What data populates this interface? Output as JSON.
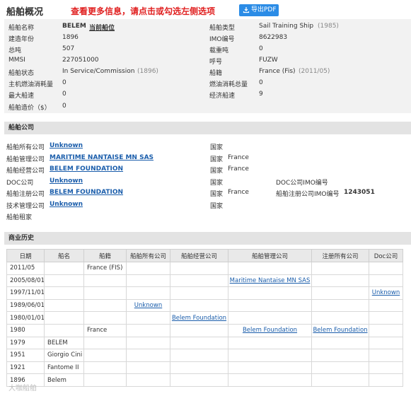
{
  "header": {
    "title": "船舶概况",
    "notice": "查看更多信息，请点击或勾选左侧选项",
    "pdf_button": "导出PDF"
  },
  "overview": {
    "name_label": "船舶名称",
    "name_value": "BELEM",
    "name_link": "当前船位",
    "type_label": "船舶类型",
    "type_value": "Sail Training Ship",
    "type_year": "(1985)",
    "built_label": "建造年份",
    "built_value": "1896",
    "imo_label": "IMO编号",
    "imo_value": "8622983",
    "gt_label": "总吨",
    "gt_value": "507",
    "dwt_label": "载重吨",
    "dwt_value": "0",
    "mmsi_label": "MMSI",
    "mmsi_value": "227051000",
    "callsign_label": "呼号",
    "callsign_value": "FUZW",
    "status_label": "船舶状态",
    "status_value": "In Service/Commission",
    "status_year": "(1896)",
    "flag_label": "船籍",
    "flag_value": "France (Fis)",
    "flag_date": "(2011/05)",
    "main_fuel_label": "主机燃油消耗量",
    "main_fuel_value": "0",
    "total_fuel_label": "燃油消耗总量",
    "total_fuel_value": "0",
    "max_speed_label": "最大船速",
    "max_speed_value": "0",
    "eco_speed_label": "经济船速",
    "eco_speed_value": "9",
    "price_label": "船舶造价（$）",
    "price_value": "0"
  },
  "company": {
    "section_title": "船舶公司",
    "country_label": "国家",
    "owner_label": "船舶所有公司",
    "owner_value": "Unknown",
    "manager_label": "船舶管理公司",
    "manager_value": "MARITIME NANTAISE MN SAS",
    "manager_country": "France",
    "operator_label": "船舶经营公司",
    "operator_value": "BELEM FOUNDATION",
    "operator_country": "France",
    "doc_label": "DOC公司",
    "doc_value": "Unknown",
    "doc_imo_label": "DOC公司IMO编号",
    "reg_owner_label": "船舶注册公司",
    "reg_owner_value": "BELEM FOUNDATION",
    "reg_owner_country": "France",
    "reg_imo_label": "船舶注册公司IMO编号",
    "reg_imo_value": "1243051",
    "tech_label": "技术管理公司",
    "tech_value": "Unknown",
    "charter_label": "船舶租家"
  },
  "history": {
    "section_title": "商业历史",
    "headers": [
      "日期",
      "船名",
      "船籍",
      "船舶所有公司",
      "船舶经营公司",
      "船舶管理公司",
      "注册所有公司",
      "Doc公司"
    ],
    "rows": [
      {
        "date": "2011/05",
        "name": "",
        "flag": "France (FIS)",
        "owner": "",
        "operator": "",
        "manager": "",
        "reg_owner": "",
        "doc": ""
      },
      {
        "date": "2005/08/01",
        "name": "",
        "flag": "",
        "owner": "",
        "operator": "",
        "manager": "Maritime Nantaise MN SAS",
        "reg_owner": "",
        "doc": ""
      },
      {
        "date": "1997/11/01",
        "name": "",
        "flag": "",
        "owner": "",
        "operator": "",
        "manager": "",
        "reg_owner": "",
        "doc": "Unknown"
      },
      {
        "date": "1989/06/01",
        "name": "",
        "flag": "",
        "owner": "Unknown",
        "operator": "",
        "manager": "",
        "reg_owner": "",
        "doc": ""
      },
      {
        "date": "1980/01/01",
        "name": "",
        "flag": "",
        "owner": "",
        "operator": "Belem Foundation",
        "manager": "",
        "reg_owner": "",
        "doc": ""
      },
      {
        "date": "1980",
        "name": "",
        "flag": "France",
        "owner": "",
        "operator": "",
        "manager": "Belem Foundation",
        "reg_owner": "Belem Foundation",
        "doc": ""
      },
      {
        "date": "1979",
        "name": "BELEM",
        "flag": "",
        "owner": "",
        "operator": "",
        "manager": "",
        "reg_owner": "",
        "doc": ""
      },
      {
        "date": "1951",
        "name": "Giorgio Cini",
        "flag": "",
        "owner": "",
        "operator": "",
        "manager": "",
        "reg_owner": "",
        "doc": ""
      },
      {
        "date": "1921",
        "name": "Fantome II",
        "flag": "",
        "owner": "",
        "operator": "",
        "manager": "",
        "reg_owner": "",
        "doc": ""
      },
      {
        "date": "1896",
        "name": "Belem",
        "flag": "",
        "owner": "",
        "operator": "",
        "manager": "",
        "reg_owner": "",
        "doc": ""
      }
    ]
  },
  "watermark": "大咖船舶"
}
